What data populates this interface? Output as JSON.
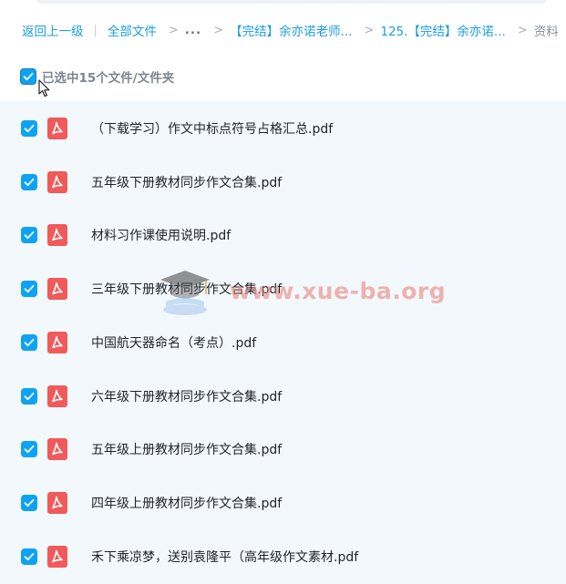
{
  "breadcrumb": {
    "back": "返回上一级",
    "all_files": "全部文件",
    "ellipsis": "...",
    "folder1": "【完结】余亦诺老师...",
    "folder2": "125.【完结】余亦诺...",
    "current": "资料",
    "bar_sep": "|",
    "arrow_sep": ">"
  },
  "selection": {
    "label": "已选中15个文件/文件夹",
    "checked": true
  },
  "files": [
    {
      "name": "（下载学习）作文中标点符号占格汇总.pdf",
      "icon": "pdf-icon",
      "checked": true
    },
    {
      "name": "五年级下册教材同步作文合集.pdf",
      "icon": "pdf-icon",
      "checked": true
    },
    {
      "name": "材料习作课使用说明.pdf",
      "icon": "pdf-icon",
      "checked": true
    },
    {
      "name": "三年级下册教材同步作文合集.pdf",
      "icon": "pdf-icon",
      "checked": true
    },
    {
      "name": "中国航天器命名（考点）.pdf",
      "icon": "pdf-icon",
      "checked": true
    },
    {
      "name": "六年级下册教材同步作文合集.pdf",
      "icon": "pdf-icon",
      "checked": true
    },
    {
      "name": "五年级上册教材同步作文合集.pdf",
      "icon": "pdf-icon",
      "checked": true
    },
    {
      "name": "四年级上册教材同步作文合集.pdf",
      "icon": "pdf-icon",
      "checked": true
    },
    {
      "name": "禾下乘凉梦，送别袁隆平（高年级作文素材.pdf",
      "icon": "pdf-icon",
      "checked": true
    }
  ],
  "watermark": {
    "text": "www.xue-ba.org"
  },
  "colors": {
    "accent": "#0ea3f2",
    "link": "#1a9de0",
    "pdf_red": "#f05a5a",
    "list_bg": "#f3f8fd"
  }
}
